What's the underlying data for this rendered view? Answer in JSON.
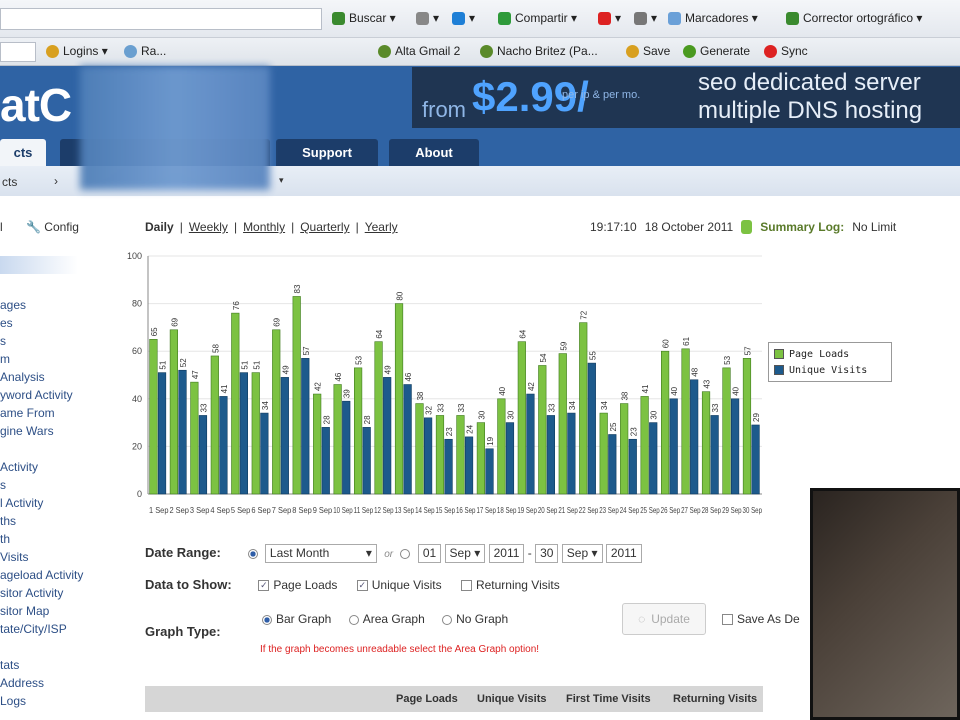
{
  "browser": {
    "toolbar1": [
      {
        "label": "Buscar ▾",
        "icon": "search-engine-icon",
        "color": "#3a8a2e"
      },
      {
        "label": "▾",
        "icon": "page-icon",
        "color": "#888"
      },
      {
        "label": "▾",
        "icon": "diamond-icon",
        "color": "#1e7fd6"
      },
      {
        "label": "Compartir ▾",
        "icon": "share-icon",
        "color": "#2e9a3a"
      },
      {
        "label": "▾",
        "icon": "pdf-icon",
        "color": "#d22"
      },
      {
        "label": "▾",
        "icon": "box-icon",
        "color": "#777"
      },
      {
        "label": "Marcadores ▾",
        "icon": "star-icon",
        "color": "#6aa0d8"
      },
      {
        "label": "Corrector ortográfico ▾",
        "icon": "spellcheck-icon",
        "color": "#3a8a2e"
      }
    ],
    "toolbar2": [
      {
        "label": "Logins ▾",
        "icon": "key-icon",
        "color": "#d8a020"
      },
      {
        "label": "Ra...",
        "icon": "globe-icon",
        "color": "#6a9fd0"
      },
      {
        "label": "Alta Gmail 2",
        "icon": "bookmark-icon",
        "color": "#5a8a2a"
      },
      {
        "label": "Nacho Britez (Pa...",
        "icon": "bookmark-icon",
        "color": "#5a8a2a"
      },
      {
        "label": "Save",
        "icon": "save-icon",
        "color": "#d8a020"
      },
      {
        "label": "Generate",
        "icon": "generate-icon",
        "color": "#4a9a20"
      },
      {
        "label": "Sync",
        "icon": "sync-icon",
        "color": "#d22"
      }
    ]
  },
  "header": {
    "logo": "atC",
    "ad": {
      "from": "from",
      "price": "$2.99/",
      "per": "per ip & per mo.",
      "line1": "seo dedicated server",
      "line2": "multiple DNS hosting"
    },
    "nav": [
      "cts",
      "Support",
      "About"
    ],
    "subnav": [
      "cts",
      "›"
    ]
  },
  "sidebar": {
    "top": [
      "l",
      "Config"
    ],
    "items": [
      "ages",
      "es",
      "s",
      "m",
      "Analysis",
      "yword Activity",
      "ame From",
      "gine Wars",
      "Activity",
      "s",
      "l Activity",
      "ths",
      "th",
      "Visits",
      "ageload Activity",
      "sitor Activity",
      "sitor Map",
      "tate/City/ISP",
      "tats",
      "Address",
      "Logs"
    ]
  },
  "periods": [
    "Daily",
    "Weekly",
    "Monthly",
    "Quarterly",
    "Yearly"
  ],
  "status": {
    "time": "19:17:10",
    "date": "18 October 2011",
    "summary_label": "Summary Log:",
    "summary_value": "No Limit"
  },
  "chart_data": {
    "type": "bar",
    "title": "",
    "xlabel": "",
    "ylabel": "",
    "ylim": [
      0,
      100
    ],
    "yticks": [
      0,
      20,
      40,
      60,
      80,
      100
    ],
    "grid": true,
    "legend": "right",
    "categories": [
      "1 Sep",
      "2 Sep",
      "3 Sep",
      "4 Sep",
      "5 Sep",
      "6 Sep",
      "7 Sep",
      "8 Sep",
      "9 Sep",
      "10 Sep",
      "11 Sep",
      "12 Sep",
      "13 Sep",
      "14 Sep",
      "15 Sep",
      "16 Sep",
      "17 Sep",
      "18 Sep",
      "19 Sep",
      "20 Sep",
      "21 Sep",
      "22 Sep",
      "23 Sep",
      "24 Sep",
      "25 Sep",
      "26 Sep",
      "27 Sep",
      "28 Sep",
      "29 Sep",
      "30 Sep"
    ],
    "series": [
      {
        "name": "Page Loads",
        "color": "#7cc242",
        "values": [
          65,
          69,
          47,
          58,
          76,
          51,
          69,
          83,
          42,
          46,
          53,
          64,
          80,
          38,
          33,
          33,
          30,
          40,
          64,
          54,
          59,
          72,
          34,
          38,
          41,
          60,
          61,
          43,
          53,
          57
        ]
      },
      {
        "name": "Unique Visits",
        "color": "#1d5a8c",
        "values": [
          51,
          52,
          33,
          41,
          51,
          34,
          49,
          57,
          28,
          39,
          28,
          49,
          46,
          32,
          23,
          24,
          19,
          30,
          42,
          33,
          34,
          55,
          25,
          23,
          30,
          40,
          48,
          33,
          40,
          29
        ]
      }
    ]
  },
  "form": {
    "date_range_label": "Date Range:",
    "range_option": "Last Month",
    "or": "or",
    "from_day": "01",
    "from_month": "Sep",
    "from_year": "2011",
    "dash": "-",
    "to_day": "30",
    "to_month": "Sep",
    "to_year": "2011",
    "data_label": "Data to Show:",
    "data_options": [
      "Page Loads",
      "Unique Visits",
      "Returning Visits"
    ],
    "graph_label": "Graph Type:",
    "graph_options": [
      "Bar Graph",
      "Area Graph",
      "No Graph"
    ],
    "update": "Update",
    "save_default": "Save As De",
    "warning": "If the graph becomes unreadable select the Area Graph option!"
  },
  "table": {
    "headers": [
      "Page Loads",
      "Unique Visits",
      "First Time Visits",
      "Returning Visits"
    ]
  }
}
